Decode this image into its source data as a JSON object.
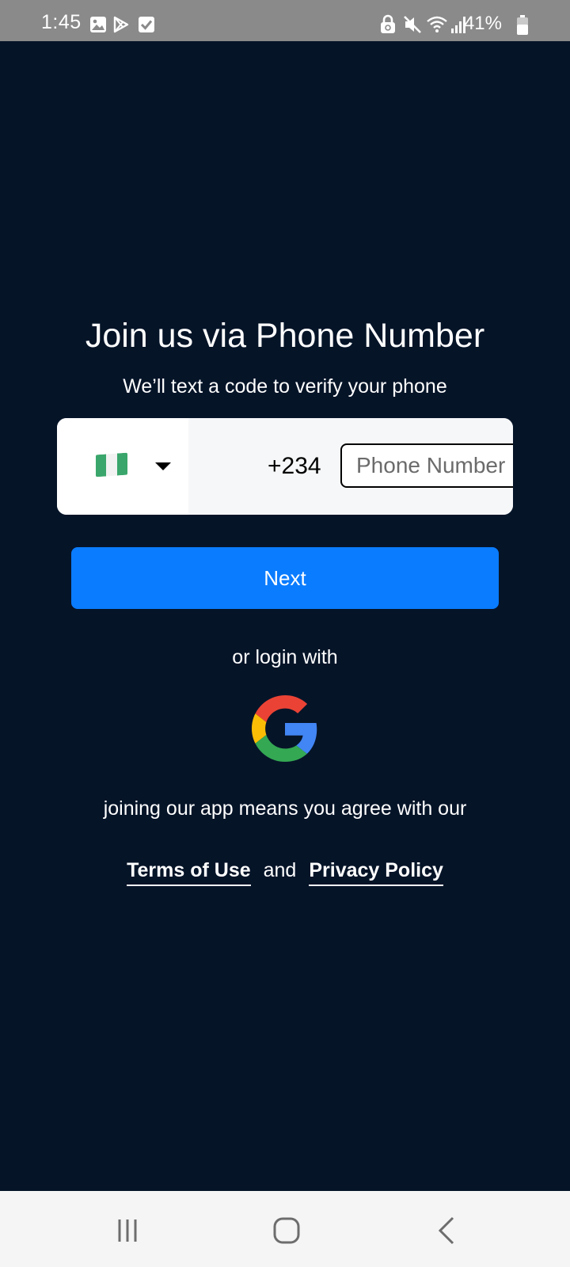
{
  "status_bar": {
    "time": "1:45",
    "icons": [
      "gallery-icon",
      "play-store-icon",
      "checkbox-icon"
    ],
    "right_icons": [
      "lock-icon",
      "mute-icon",
      "wifi-icon",
      "signal-icon"
    ],
    "battery": "41%"
  },
  "signup": {
    "title": "Join us via Phone Number",
    "subtitle": "We’ll text a code to verify your phone",
    "country": {
      "flag": "nigeria-flag",
      "flag_colors": [
        "#008751",
        "#ffffff",
        "#008751"
      ],
      "dial_code": "+234"
    },
    "phone_input": {
      "value": "",
      "placeholder": "Phone Number"
    },
    "next_label": "Next",
    "or_login": "or login with",
    "google_icon": "google-icon",
    "agree_text": "joining our app means you agree with our",
    "terms_label": "Terms of Use",
    "and_label": "and",
    "privacy_label": "Privacy Policy"
  },
  "colors": {
    "background": "#061428",
    "accent": "#0a7cff"
  },
  "nav_bar": {
    "buttons": [
      "recents-icon",
      "home-icon",
      "back-icon"
    ]
  }
}
